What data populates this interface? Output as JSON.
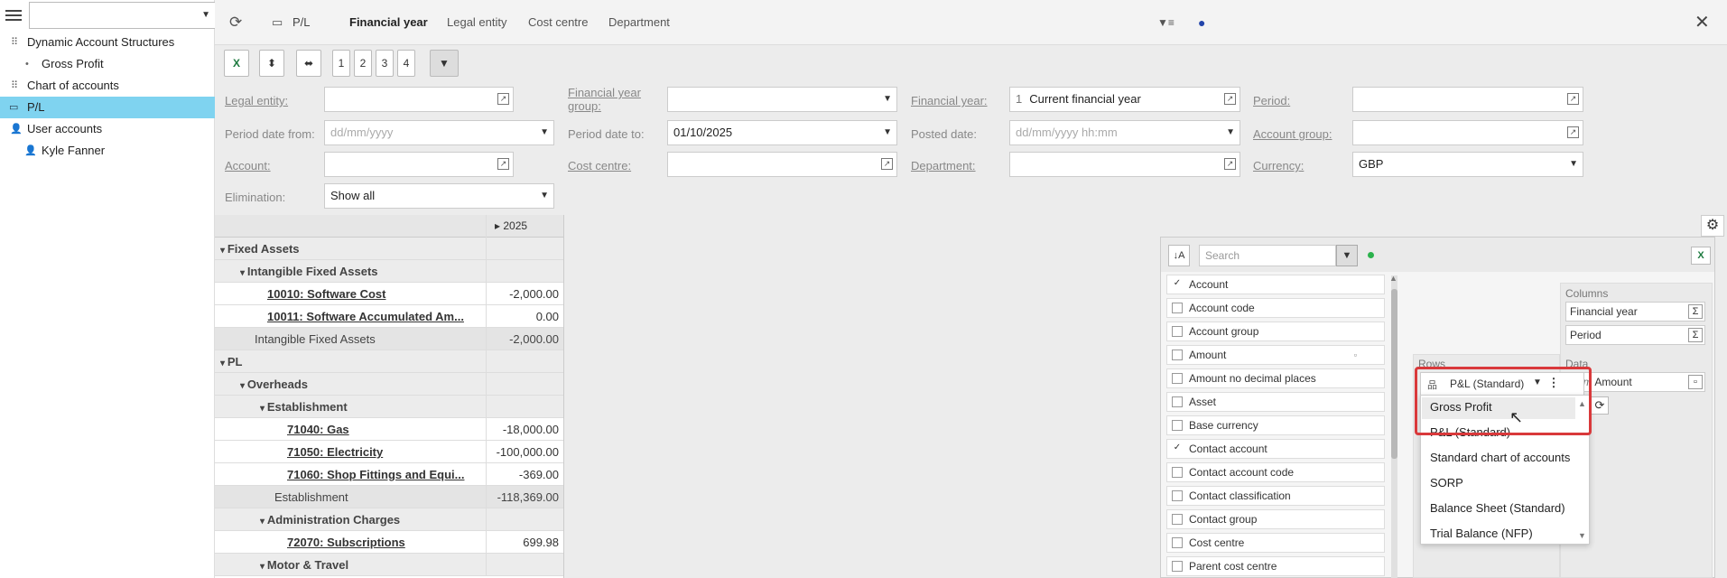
{
  "left_panel": {
    "items": [
      {
        "label": "Dynamic Account Structures",
        "icon": "grid-icon"
      },
      {
        "label": "Gross Profit",
        "icon": "bullet-icon"
      },
      {
        "label": "Chart of accounts",
        "icon": "grid-icon"
      },
      {
        "label": "P/L",
        "icon": "book-icon"
      },
      {
        "label": "User accounts",
        "icon": "user-icon"
      },
      {
        "label": "Kyle Fanner",
        "icon": "user-icon"
      }
    ]
  },
  "header": {
    "title": "P/L",
    "tabs": [
      "Financial year",
      "Legal entity",
      "Cost centre",
      "Department"
    ]
  },
  "toolbar": {
    "levels": [
      "1",
      "2",
      "3",
      "4"
    ]
  },
  "filters": {
    "legal_entity": {
      "label": "Legal entity:",
      "value": ""
    },
    "financial_year_group": {
      "label": "Financial year group:",
      "value": ""
    },
    "financial_year": {
      "label": "Financial year:",
      "badge": "1",
      "value": "Current financial year"
    },
    "period": {
      "label": "Period:",
      "value": ""
    },
    "period_date_from": {
      "label": "Period date from:",
      "placeholder": "dd/mm/yyyy"
    },
    "period_date_to": {
      "label": "Period date to:",
      "value": "01/10/2025"
    },
    "posted_date": {
      "label": "Posted date:",
      "placeholder": "dd/mm/yyyy hh:mm"
    },
    "account_group": {
      "label": "Account group:",
      "value": ""
    },
    "account": {
      "label": "Account:",
      "value": ""
    },
    "cost_centre": {
      "label": "Cost centre:",
      "value": ""
    },
    "department": {
      "label": "Department:",
      "value": ""
    },
    "currency": {
      "label": "Currency:",
      "value": "GBP"
    },
    "elimination": {
      "label": "Elimination:",
      "value": "Show all"
    }
  },
  "grid": {
    "column_header": "2025",
    "rows": [
      {
        "label": "Fixed Assets",
        "value": "",
        "kind": "group",
        "indent": 0
      },
      {
        "label": "Intangible Fixed Assets",
        "value": "",
        "kind": "group",
        "indent": 1
      },
      {
        "label": "10010: Software Cost",
        "value": "-2,000.00",
        "kind": "account",
        "indent": 2
      },
      {
        "label": "10011: Software Accumulated Am...",
        "value": "0.00",
        "kind": "account",
        "indent": 2
      },
      {
        "label": "Intangible Fixed Assets",
        "value": "-2,000.00",
        "kind": "subtotal",
        "indent": 1
      },
      {
        "label": "PL",
        "value": "",
        "kind": "group",
        "indent": 0
      },
      {
        "label": "Overheads",
        "value": "",
        "kind": "group",
        "indent": 1
      },
      {
        "label": "Establishment",
        "value": "",
        "kind": "group",
        "indent": 2
      },
      {
        "label": "71040: Gas",
        "value": "-18,000.00",
        "kind": "account",
        "indent": 3
      },
      {
        "label": "71050: Electricity",
        "value": "-100,000.00",
        "kind": "account",
        "indent": 3
      },
      {
        "label": "71060: Shop Fittings and Equi...",
        "value": "-369.00",
        "kind": "account",
        "indent": 3
      },
      {
        "label": "Establishment",
        "value": "-118,369.00",
        "kind": "subtotal",
        "indent": 2
      },
      {
        "label": "Administration Charges",
        "value": "",
        "kind": "group",
        "indent": 2
      },
      {
        "label": "72070: Subscriptions",
        "value": "699.98",
        "kind": "account",
        "indent": 3
      },
      {
        "label": "Motor & Travel",
        "value": "",
        "kind": "group",
        "indent": 2
      }
    ]
  },
  "pivot": {
    "search_placeholder": "Search",
    "fields": [
      {
        "label": "Account",
        "checked": true
      },
      {
        "label": "Account code",
        "checked": false
      },
      {
        "label": "Account group",
        "checked": false
      },
      {
        "label": "Amount",
        "checked": false
      },
      {
        "label": "Amount no decimal places",
        "checked": false
      },
      {
        "label": "Asset",
        "checked": false
      },
      {
        "label": "Base currency",
        "checked": false
      },
      {
        "label": "Contact account",
        "checked": true
      },
      {
        "label": "Contact account code",
        "checked": false
      },
      {
        "label": "Contact classification",
        "checked": false
      },
      {
        "label": "Contact group",
        "checked": false
      },
      {
        "label": "Cost centre",
        "checked": false
      },
      {
        "label": "Parent cost centre",
        "checked": false
      }
    ],
    "columns_label": "Columns",
    "columns": [
      "Financial year",
      "Period"
    ],
    "rows_label": "Rows",
    "rows_value": "P&L (Standard)",
    "data_label": "Data",
    "data_func": "Sum",
    "data_value": "Amount",
    "dropdown_options": [
      "Gross Profit",
      "P&L (Standard)",
      "Standard chart of accounts",
      "SORP",
      "Balance Sheet (Standard)",
      "Trial Balance (NFP)"
    ],
    "selected_hover": "Gross Profit"
  },
  "colors": {
    "selection": "#7fd3f0",
    "highlight_box": "#d9393b",
    "excel_green": "#1d7a3f"
  }
}
